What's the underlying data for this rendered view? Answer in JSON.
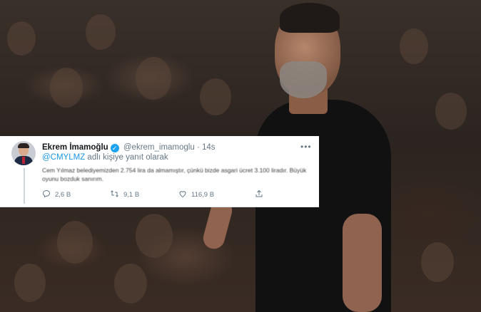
{
  "tweet": {
    "name": "Ekrem İmamoğlu",
    "handle": "@ekrem_imamoglu",
    "separator": "·",
    "time": "14s",
    "more": "•••",
    "reply_mention": "@CMYLMZ",
    "reply_suffix": " adlı kişiye yanıt olarak",
    "body": "Cem Yılmaz belediyemizden 2.754 lira da almamıştır, çünkü bizde asgari ücret 3.100 liradır. Büyük oyunu bozduk sanırım.",
    "actions": {
      "reply_count": "2,6 B",
      "retweet_count": "9,1 B",
      "like_count": "116,9 B"
    },
    "colors": {
      "accent": "#1b95e0",
      "verified": "#1da1f2",
      "text": "#14171a",
      "muted": "#657786"
    },
    "icons": [
      "verified-badge-icon",
      "more-icon",
      "reply-icon",
      "retweet-icon",
      "like-icon",
      "share-icon"
    ]
  }
}
